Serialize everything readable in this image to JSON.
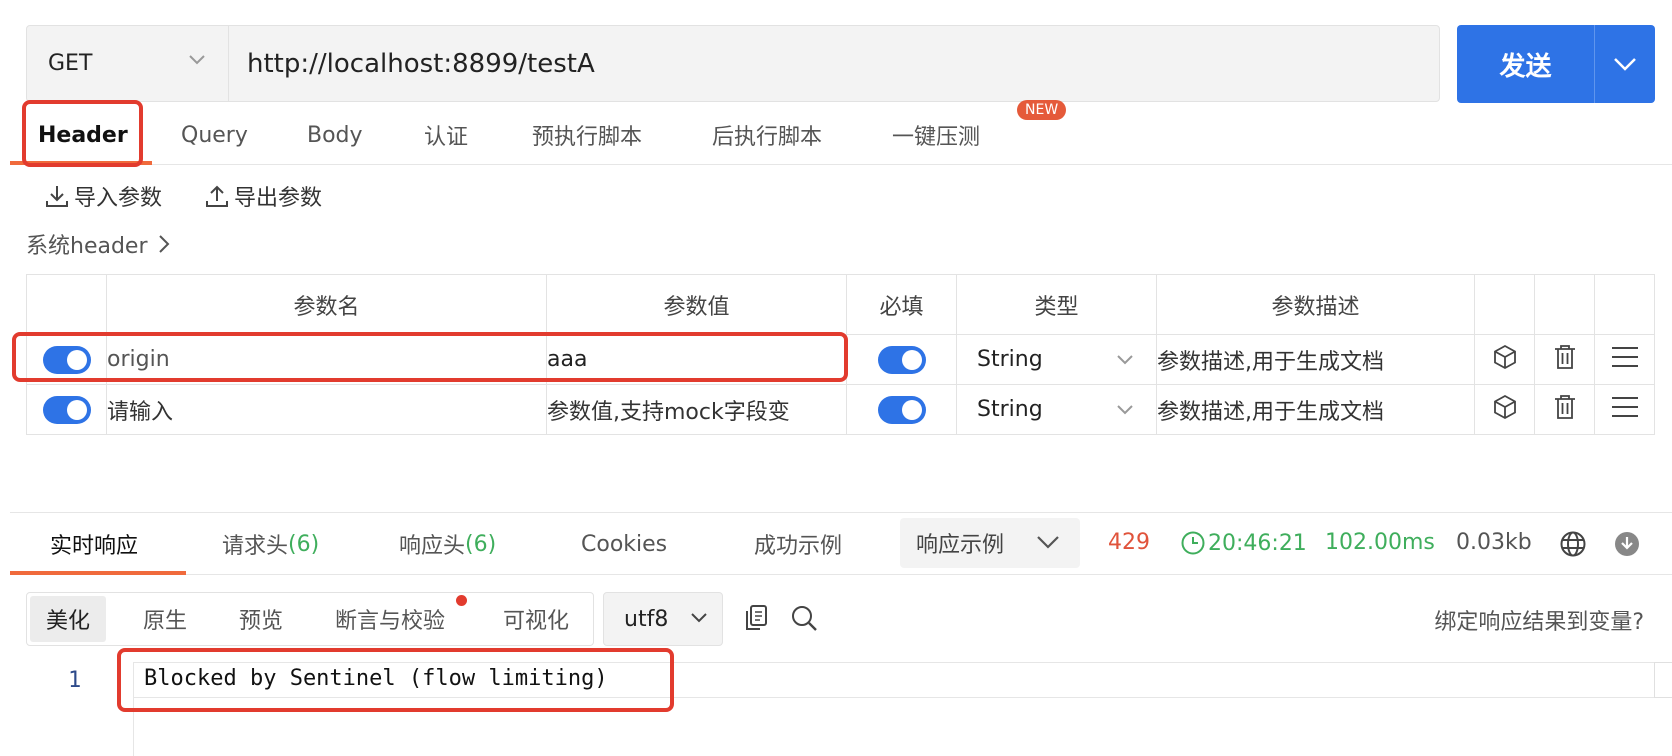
{
  "request": {
    "method": "GET",
    "url": "http://localhost:8899/testA",
    "send_label": "发送"
  },
  "req_tabs": [
    {
      "label": "Header",
      "active": true
    },
    {
      "label": "Query"
    },
    {
      "label": "Body"
    },
    {
      "label": "认证"
    },
    {
      "label": "预执行脚本"
    },
    {
      "label": "后执行脚本"
    },
    {
      "label": "一键压测"
    }
  ],
  "new_badge": "NEW",
  "tools": {
    "import_label": "导入参数",
    "export_label": "导出参数",
    "sys_header": "系统header"
  },
  "param_table": {
    "headers": [
      "参数名",
      "参数值",
      "必填",
      "类型",
      "参数描述"
    ],
    "rows": [
      {
        "enabled": true,
        "name": "origin",
        "value": "aaa",
        "required": true,
        "type": "String",
        "desc_placeholder": "参数描述,用于生成文档"
      },
      {
        "enabled": true,
        "name_placeholder": "请输入",
        "value_placeholder": "参数值,支持mock字段变",
        "required": true,
        "type": "String",
        "desc_placeholder": "参数描述,用于生成文档"
      }
    ]
  },
  "resp_tabs": {
    "realtime": "实时响应",
    "req_headers": "请求头",
    "req_headers_count": "(6)",
    "resp_headers": "响应头",
    "resp_headers_count": "(6)",
    "cookies": "Cookies",
    "success_example": "成功示例",
    "example_select": "响应示例"
  },
  "status": {
    "code": "429",
    "time": "20:46:21",
    "duration": "102.00ms",
    "size": "0.03kb"
  },
  "view_modes": [
    "美化",
    "原生",
    "预览",
    "断言与校验",
    "可视化"
  ],
  "encoding": "utf8",
  "bind_label": "绑定响应结果到变量?",
  "response_body": {
    "line_number": "1",
    "text": "Blocked by Sentinel (flow limiting)"
  },
  "colors": {
    "accent": "#2e73e6",
    "tab_underline": "#f06a3c",
    "status_error": "#e0533b",
    "status_ok": "#3fae5c",
    "highlight_box": "#e23b2e"
  }
}
